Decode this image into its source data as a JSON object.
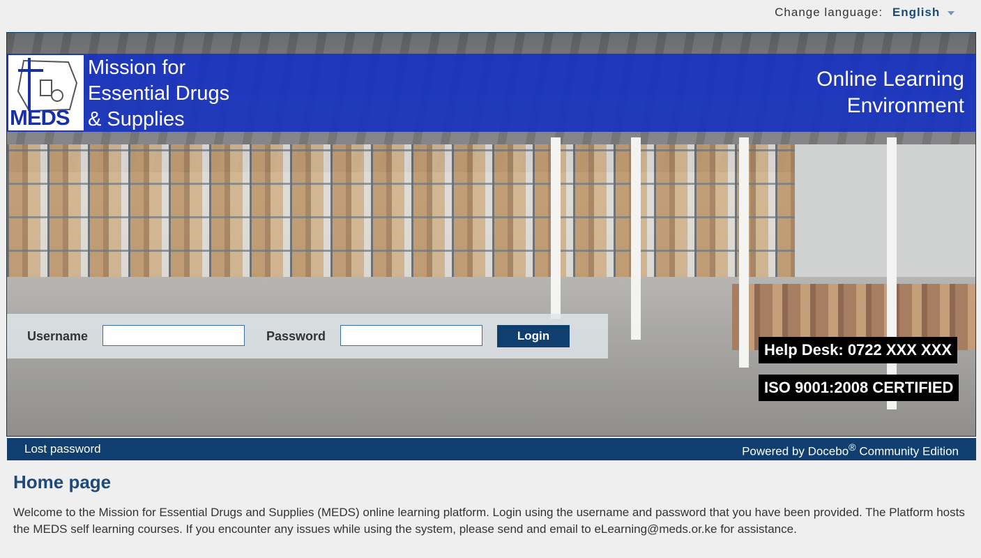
{
  "language": {
    "label": "Change language:",
    "value": "English"
  },
  "header": {
    "logo_text": "MEDS",
    "org_name_line1": "Mission for",
    "org_name_line2": "Essential Drugs",
    "org_name_line3": "& Supplies",
    "platform_line1": "Online Learning",
    "platform_line2": "Environment"
  },
  "login": {
    "username_label": "Username",
    "username_value": "",
    "password_label": "Password",
    "password_value": "",
    "button_label": "Login"
  },
  "badges": {
    "help_desk": "Help Desk: 0722 XXX XXX",
    "iso": "ISO 9001:2008 CERTIFIED"
  },
  "footer": {
    "lost_password": "Lost password",
    "powered_prefix": "Powered by Docebo",
    "registered": "®",
    "powered_suffix": " Community Edition"
  },
  "main": {
    "title": "Home page",
    "body": "Welcome to the Mission for Essential Drugs and Supplies (MEDS) online learning platform. Login using the username and password that you have been provided. The Platform hosts the MEDS self learning courses. If you encounter any issues while using the system, please send and email to eLearning@meds.or.ke for assistance."
  }
}
